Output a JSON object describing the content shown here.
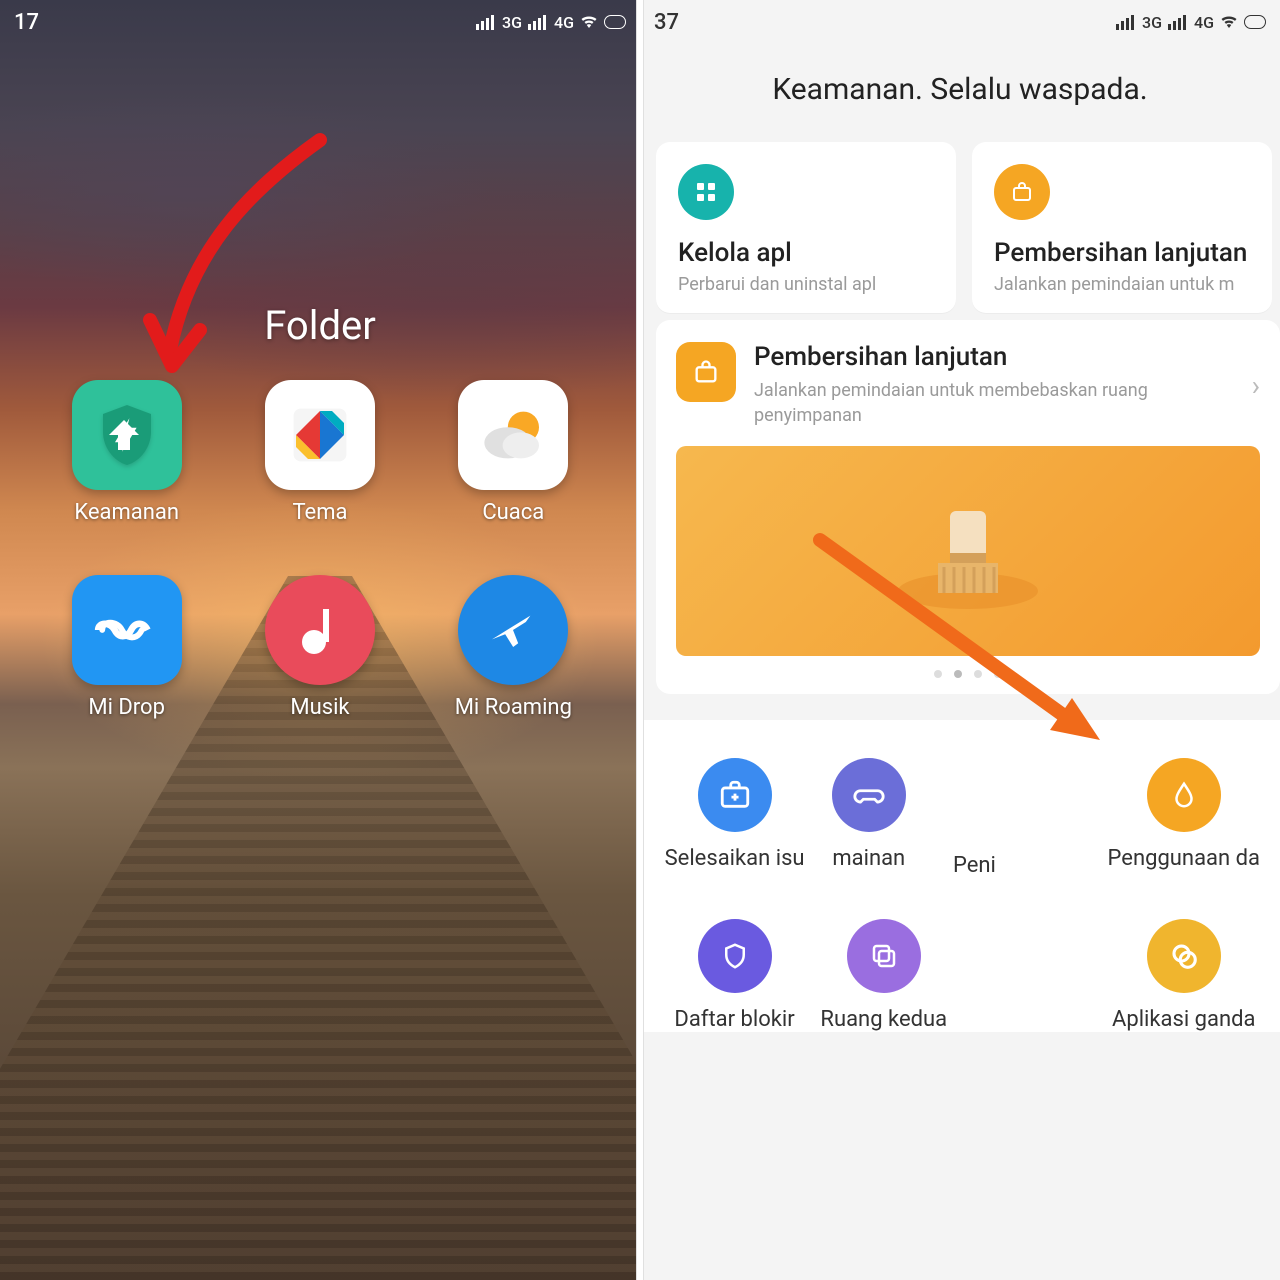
{
  "left": {
    "status_time": "17",
    "status_net1": "3G",
    "status_net2": "4G",
    "folder_title": "Folder",
    "apps": [
      {
        "id": "keamanan",
        "label": "Keamanan"
      },
      {
        "id": "tema",
        "label": "Tema"
      },
      {
        "id": "cuaca",
        "label": "Cuaca"
      },
      {
        "id": "midrop",
        "label": "Mi Drop"
      },
      {
        "id": "musik",
        "label": "Musik"
      },
      {
        "id": "miroaming",
        "label": "Mi Roaming"
      }
    ]
  },
  "right": {
    "status_time": "37",
    "status_net1": "3G",
    "status_net2": "4G",
    "header": "Keamanan. Selalu waspada.",
    "cards": [
      {
        "icon": "grid",
        "color": "teal",
        "title": "Kelola apl",
        "subtitle": "Perbarui dan uninstal apl"
      },
      {
        "icon": "bag",
        "color": "orange",
        "title": "Pembersihan lanjutan",
        "subtitle": "Jalankan pemindaian untuk m"
      }
    ],
    "featured": {
      "title": "Pembersihan lanjutan",
      "subtitle": "Jalankan pemindaian untuk membebaskan ruang penyimpanan"
    },
    "page_dots": {
      "count": 4,
      "active": 1
    },
    "tools_row1": [
      {
        "id": "isu",
        "label": "Selesaikan isu",
        "color": "c-blue",
        "icon": "medkit"
      },
      {
        "id": "mainan",
        "label": "mainan",
        "color": "c-indigo",
        "icon": "game"
      },
      {
        "id": "peni",
        "label": "Peni",
        "color": "c-peach",
        "icon": "drop",
        "hidden_row_label": true
      },
      {
        "id": "data",
        "label": "Penggunaan da",
        "color": "c-orange",
        "icon": "drop"
      }
    ],
    "tools_row2": [
      {
        "id": "blokir",
        "label": "Daftar blokir",
        "color": "c-violet",
        "icon": "shield"
      },
      {
        "id": "ruang",
        "label": "Ruang kedua",
        "color": "c-purple",
        "icon": "dual"
      },
      {
        "id": "ganda",
        "label": "Aplikasi ganda",
        "color": "c-yellow",
        "icon": "copy"
      }
    ]
  }
}
